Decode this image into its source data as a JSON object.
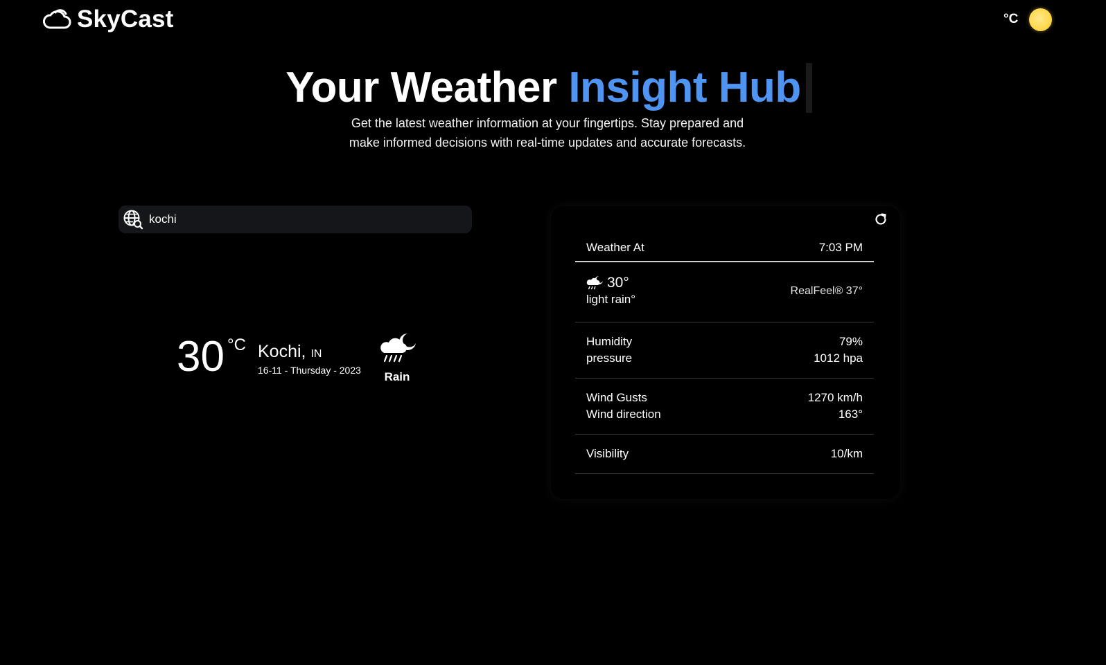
{
  "app": {
    "name": "SkyCast"
  },
  "header": {
    "unit_toggle_label": "°C"
  },
  "hero": {
    "title_plain": "Your Weather ",
    "title_accent": "Insight  Hub",
    "subtitle": "Get the latest weather information at your fingertips. Stay prepared and make informed decisions with real-time updates and accurate forecasts."
  },
  "search": {
    "value": "kochi"
  },
  "current": {
    "temperature": "30",
    "unit": "°C",
    "city": "Kochi,",
    "country": "IN",
    "date": "16-11 - Thursday - 2023",
    "condition": "Rain",
    "icon": "rain-night-icon"
  },
  "details": {
    "weather_at_label": "Weather At",
    "weather_at_time": "7:03 PM",
    "now_temp": "30°",
    "description": "light rain°",
    "realfeel": "RealFeel® 37°",
    "humidity_label": "Humidity",
    "humidity_value": "79%",
    "pressure_label": "pressure",
    "pressure_value": "1012 hpa",
    "wind_gusts_label": "Wind Gusts",
    "wind_gusts_value": "1270 km/h",
    "wind_direction_label": "Wind direction",
    "wind_direction_value": "163°",
    "visibility_label": "Visibility",
    "visibility_value": "10/km"
  },
  "colors": {
    "accent": "#4f94f0",
    "background": "#000000",
    "search_bg": "#15161a",
    "sun": "#ffd84d"
  }
}
